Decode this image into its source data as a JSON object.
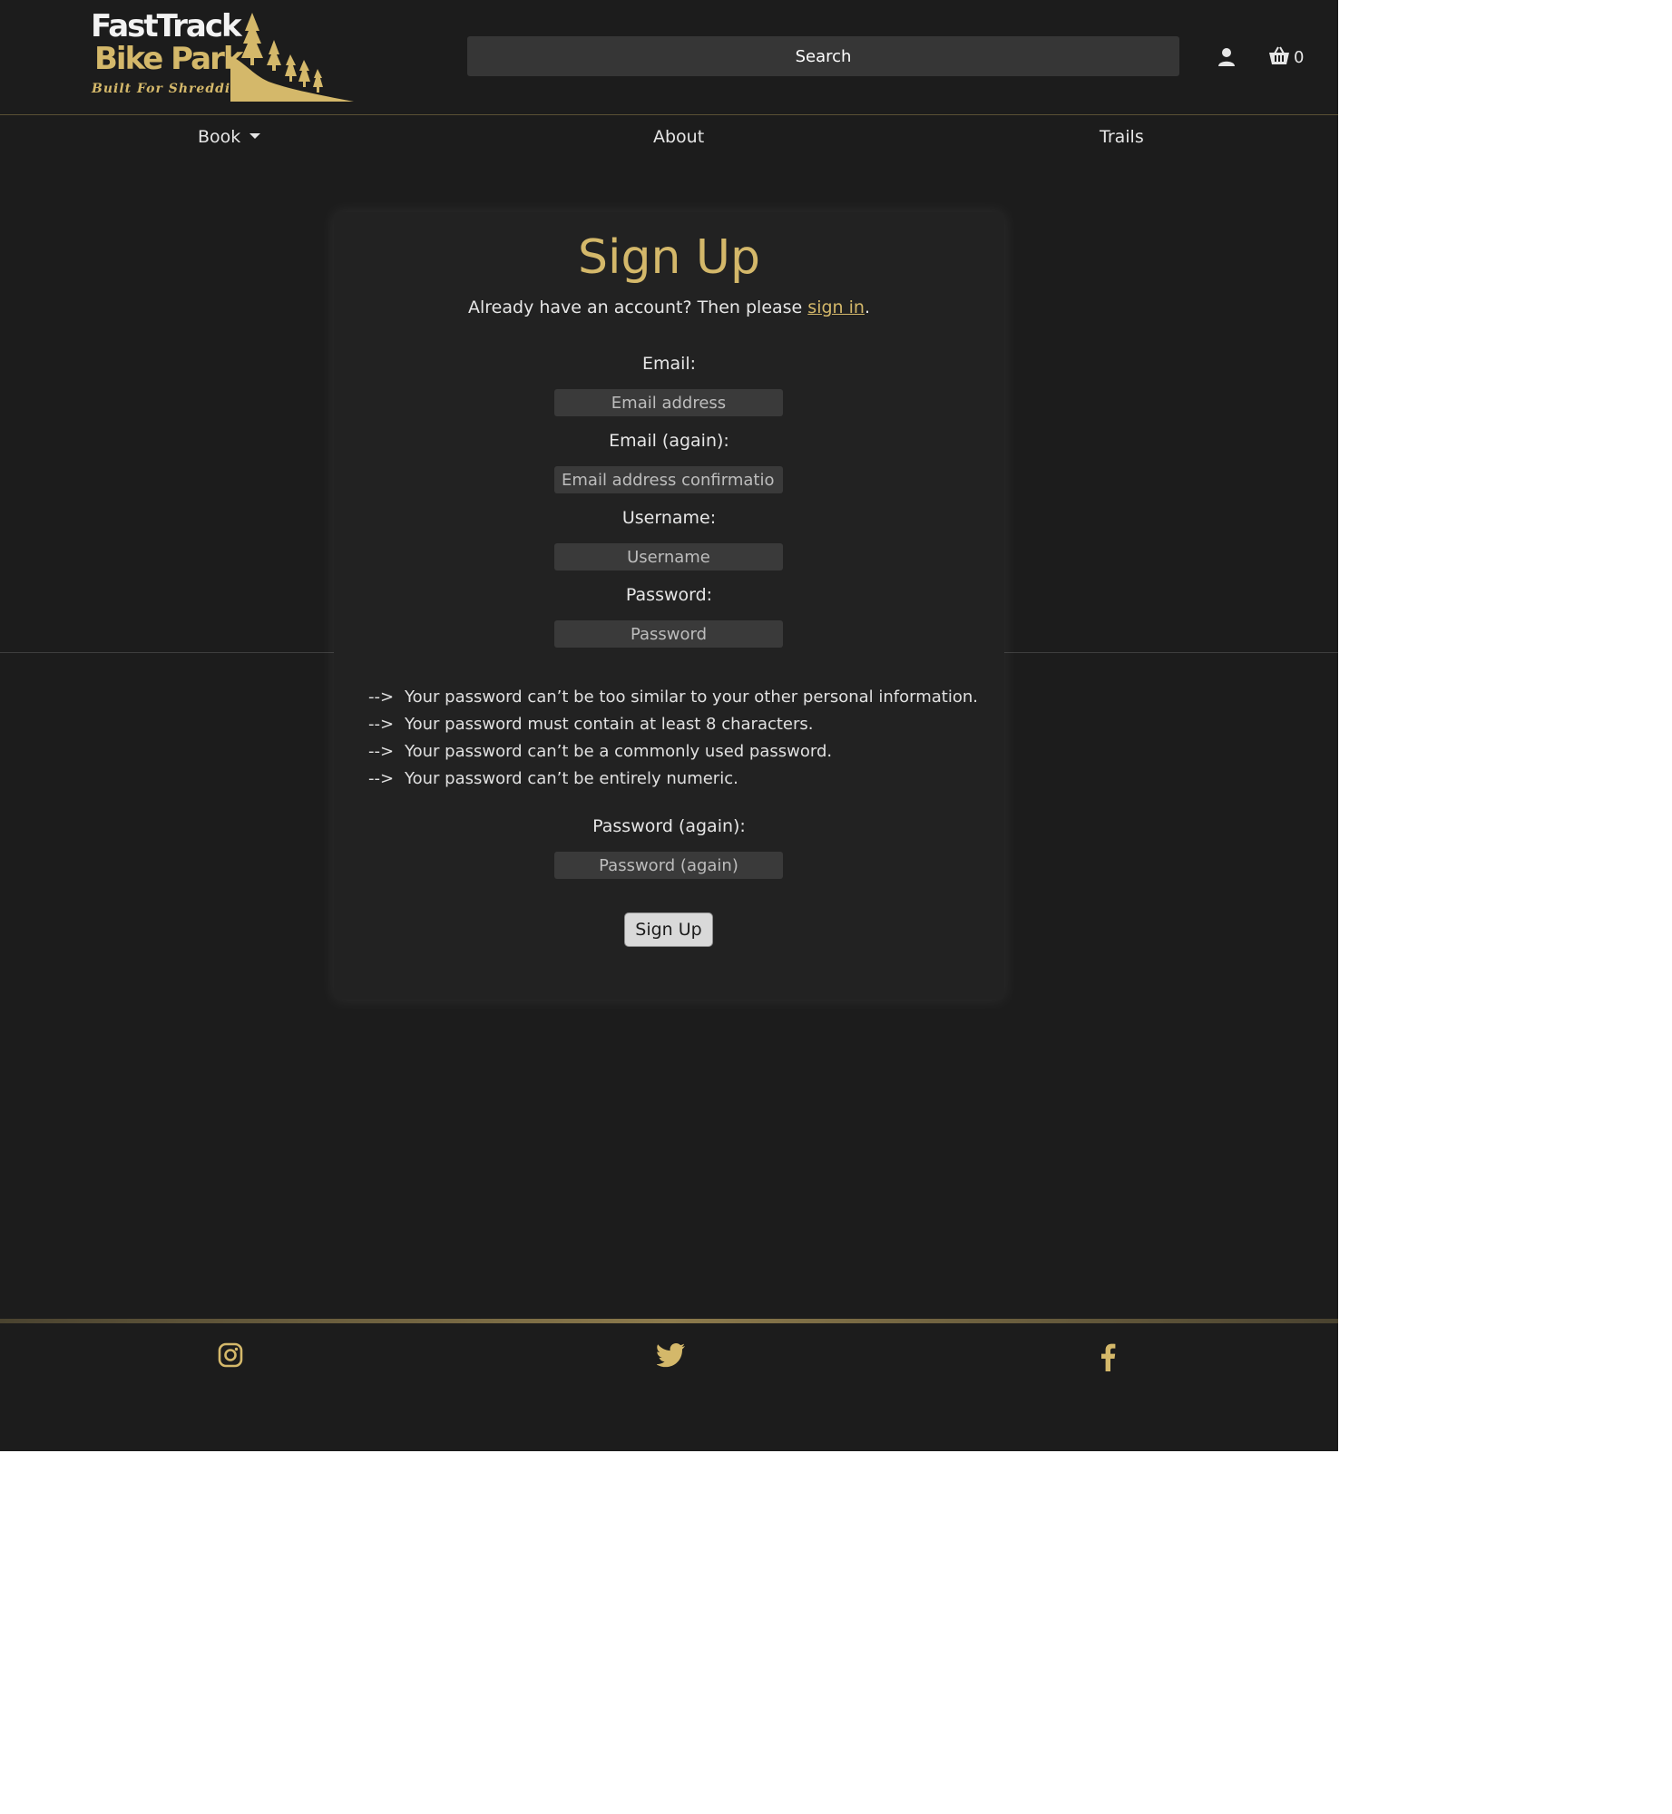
{
  "brand": {
    "line1": "FastTrack",
    "line2": "Bike Park",
    "tagline": "Built For Shredding",
    "accent_color": "#d4b86a"
  },
  "header": {
    "search_placeholder": "Search",
    "account_icon": "user-icon",
    "cart_icon": "basket-icon",
    "cart_count": "0"
  },
  "nav": {
    "book": "Book",
    "about": "About",
    "trails": "Trails"
  },
  "signup": {
    "title": "Sign Up",
    "subtitle_prefix": "Already have an account? Then please ",
    "signin_link": "sign in",
    "subtitle_suffix": ".",
    "email_label": "Email:",
    "email_placeholder": "Email address",
    "email2_label": "Email (again):",
    "email2_placeholder": "Email address confirmation",
    "username_label": "Username:",
    "username_placeholder": "Username",
    "password_label": "Password:",
    "password_placeholder": "Password",
    "help": [
      {
        "arrow": "-->",
        "text": "Your password can’t be too similar to your other personal information."
      },
      {
        "arrow": "-->",
        "text": "Your password must contain at least 8 characters."
      },
      {
        "arrow": "-->",
        "text": "Your password can’t be a commonly used password."
      },
      {
        "arrow": "-->",
        "text": "Your password can’t be entirely numeric."
      }
    ],
    "password2_label": "Password (again):",
    "password2_placeholder": "Password (again)",
    "submit_label": "Sign Up"
  },
  "footer": {
    "icons": [
      "instagram-icon",
      "twitter-icon",
      "facebook-icon"
    ]
  }
}
